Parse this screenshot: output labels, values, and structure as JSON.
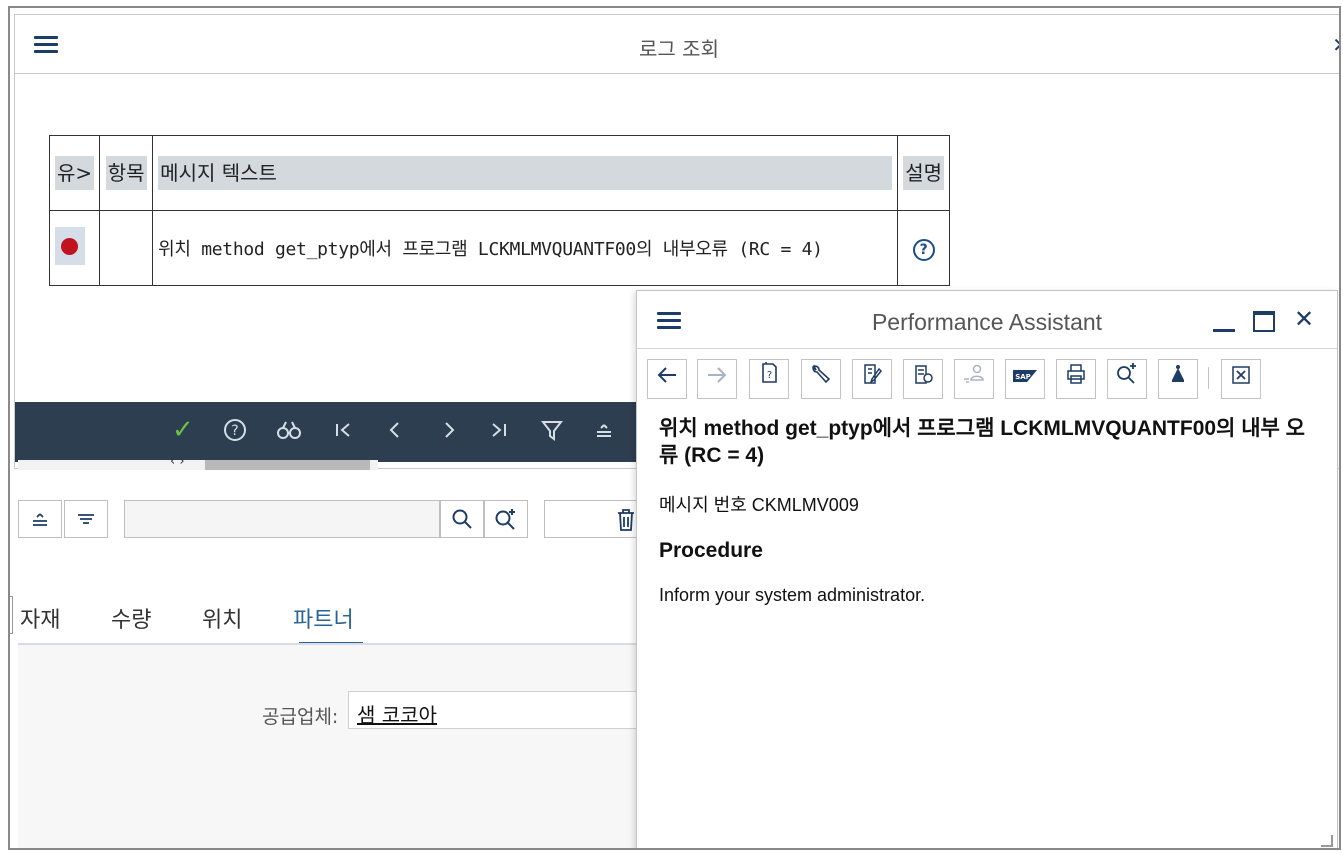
{
  "log_dialog": {
    "title": "로그 조회",
    "columns": {
      "type": "유>",
      "item": "항목",
      "message": "메시지 텍스트",
      "description": "설명"
    },
    "rows": [
      {
        "status": "error",
        "item": "",
        "message": "위치 method get_ptyp에서 프로그램 LCKMLMVQUANTF00의 내부오류 (RC = 4)",
        "help": "?"
      }
    ]
  },
  "background_app": {
    "tabs": [
      "자재",
      "수량",
      "위치",
      "파트너"
    ],
    "active_tab": "파트너",
    "supplier_label": "공급업체:",
    "supplier_value": "샘 코코아"
  },
  "assistant": {
    "title": "Performance Assistant",
    "heading": "위치 method get_ptyp에서 프로그램 LCKMLMVQUANTF00의 내부 오류 (RC = 4)",
    "message_number": "메시지 번호 CKMLMV009",
    "procedure_title": "Procedure",
    "procedure_text": "Inform your system administrator."
  },
  "colors": {
    "accent": "#2a6496",
    "toolbar_dark": "#2c3e50",
    "error": "#c1121f",
    "ok": "#6bc04b"
  }
}
